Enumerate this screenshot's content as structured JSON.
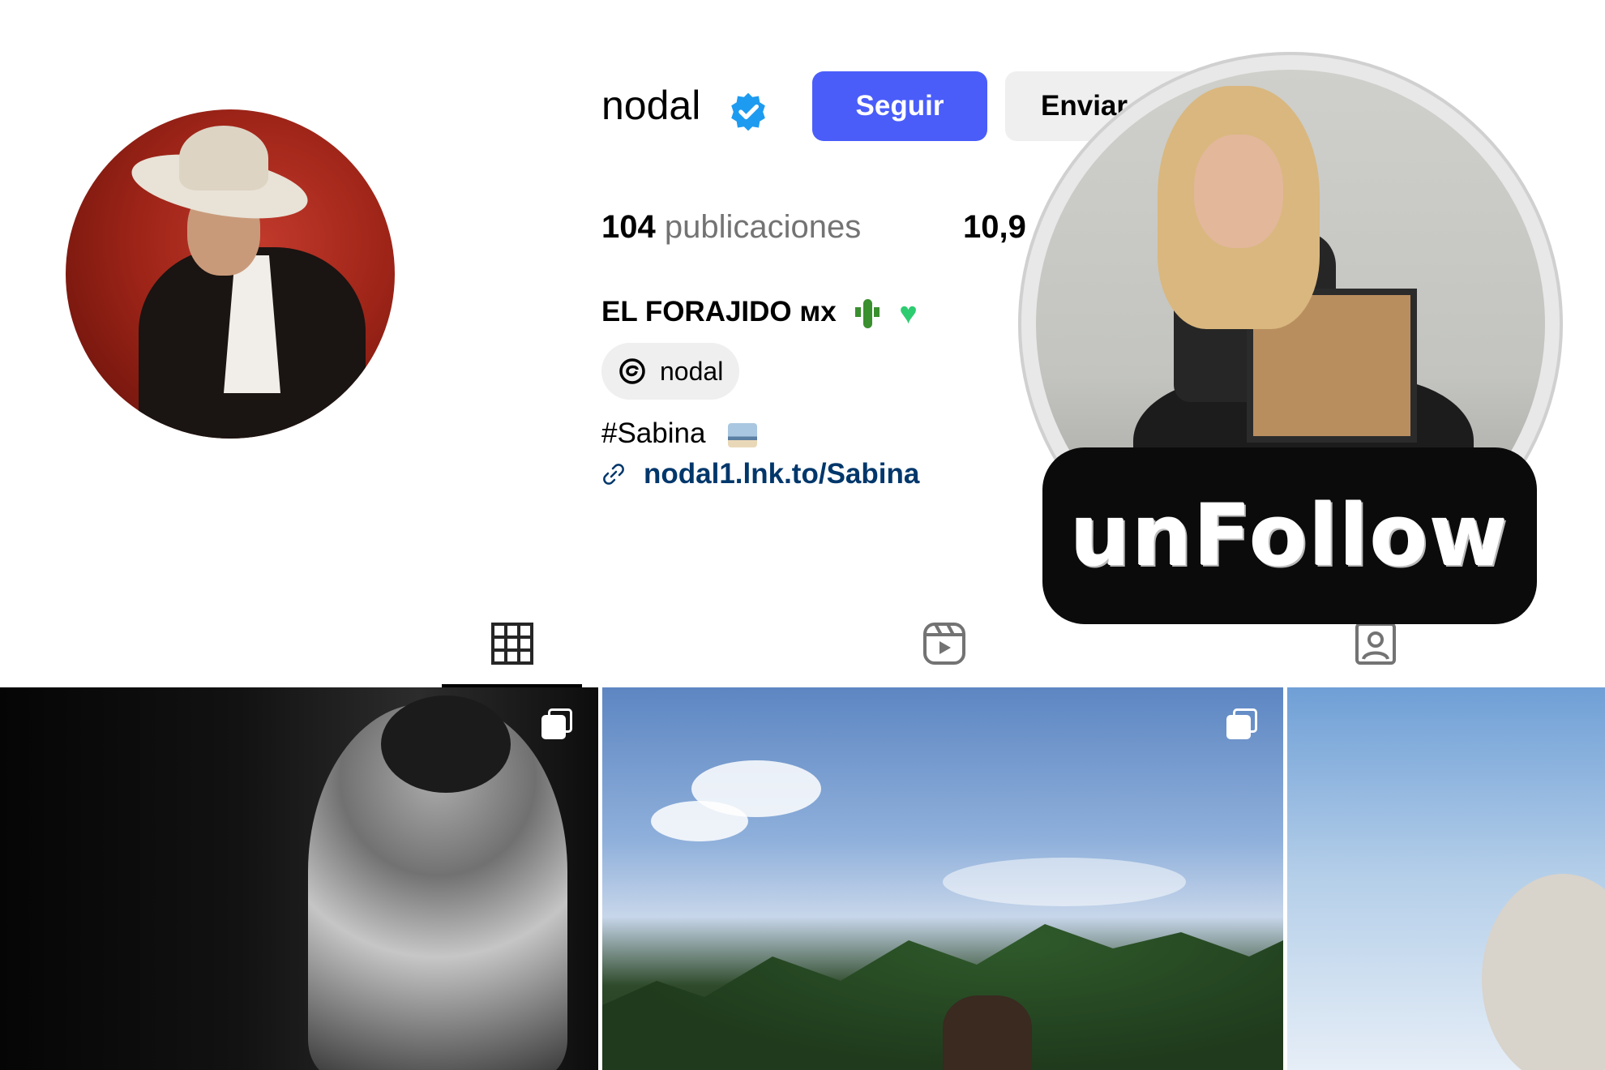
{
  "profile": {
    "username": "nodal",
    "follow_label": "Seguir",
    "message_label": "Enviar",
    "stats": {
      "posts_count": "104",
      "posts_label": "publicaciones",
      "followers_partial": "10,9"
    },
    "full_name": "EL FORAJIDO ᴍx",
    "threads_handle": "nodal",
    "bio_hashtag": "#Sabina",
    "link_text": "nodal1.lnk.to/Sabina"
  },
  "tabs": [
    {
      "name": "posts",
      "icon": "grid-icon",
      "active": true
    },
    {
      "name": "reels",
      "icon": "reels-icon",
      "active": false
    },
    {
      "name": "tagged",
      "icon": "tagged-icon",
      "active": false
    }
  ],
  "overlay": {
    "sticker_text": "unFollow"
  },
  "colors": {
    "follow_button": "#4a5df9",
    "link": "#00376b",
    "verified": "#1d9bf0",
    "sticker_bg": "#0b0b0b"
  }
}
